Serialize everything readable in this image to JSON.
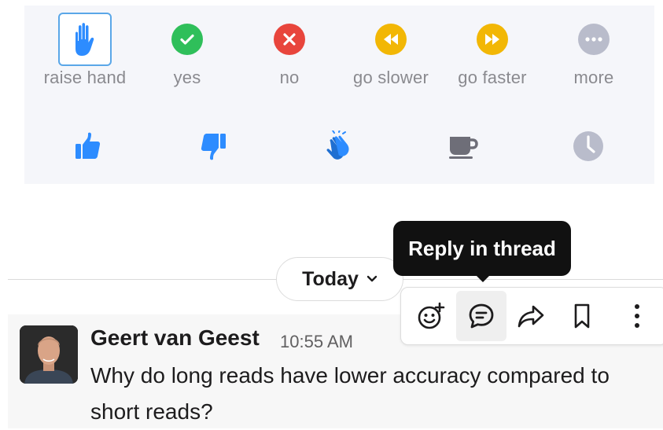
{
  "reactions": {
    "row1": [
      {
        "label": "raise hand",
        "icon": "raise-hand-icon",
        "selected": true
      },
      {
        "label": "yes",
        "icon": "check-circle-icon",
        "color": "#2fbf5a"
      },
      {
        "label": "no",
        "icon": "x-circle-icon",
        "color": "#e8453c"
      },
      {
        "label": "go slower",
        "icon": "rewind-circle-icon",
        "color": "#f2b705"
      },
      {
        "label": "go faster",
        "icon": "fast-forward-circle-icon",
        "color": "#f2b705"
      },
      {
        "label": "more",
        "icon": "more-circle-icon",
        "color": "#b9bccb"
      }
    ],
    "row2": [
      {
        "icon": "thumbs-up-icon",
        "color": "#2d8cff"
      },
      {
        "icon": "thumbs-down-icon",
        "color": "#2d8cff"
      },
      {
        "icon": "clapping-hands-icon",
        "color": "#2d8cff"
      },
      {
        "icon": "coffee-cup-icon",
        "color": "#6e6e78"
      },
      {
        "icon": "clock-icon",
        "color": "#b9bccb"
      }
    ]
  },
  "day_divider": {
    "label": "Today"
  },
  "tooltip": {
    "text": "Reply in thread"
  },
  "message_actions": [
    "add-reaction-icon",
    "reply-in-thread-icon",
    "share-icon",
    "bookmark-icon",
    "more-actions-icon"
  ],
  "message": {
    "author": "Geert van Geest",
    "time": "10:55 AM",
    "text": "Why do long reads have lower accuracy compared to short reads?"
  }
}
